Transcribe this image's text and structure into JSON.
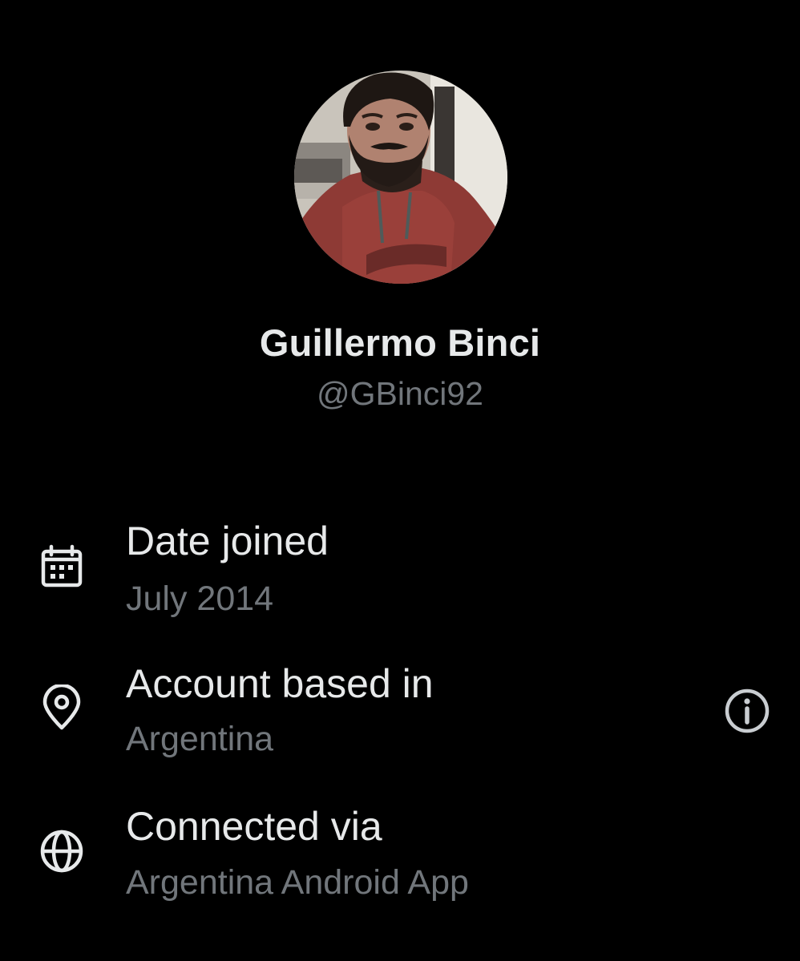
{
  "profile": {
    "display_name": "Guillermo Binci",
    "handle": "@GBinci92"
  },
  "about": {
    "rows": [
      {
        "icon": "calendar-icon",
        "title": "Date joined",
        "value": "July 2014"
      },
      {
        "icon": "location-pin-icon",
        "title": "Account based in",
        "value": "Argentina",
        "action_icon": "info-icon"
      },
      {
        "icon": "globe-icon",
        "title": "Connected via",
        "value": "Argentina Android App"
      }
    ]
  },
  "colors": {
    "background": "#000000",
    "primary_text": "#e7e9ea",
    "secondary_text": "#71767b"
  }
}
